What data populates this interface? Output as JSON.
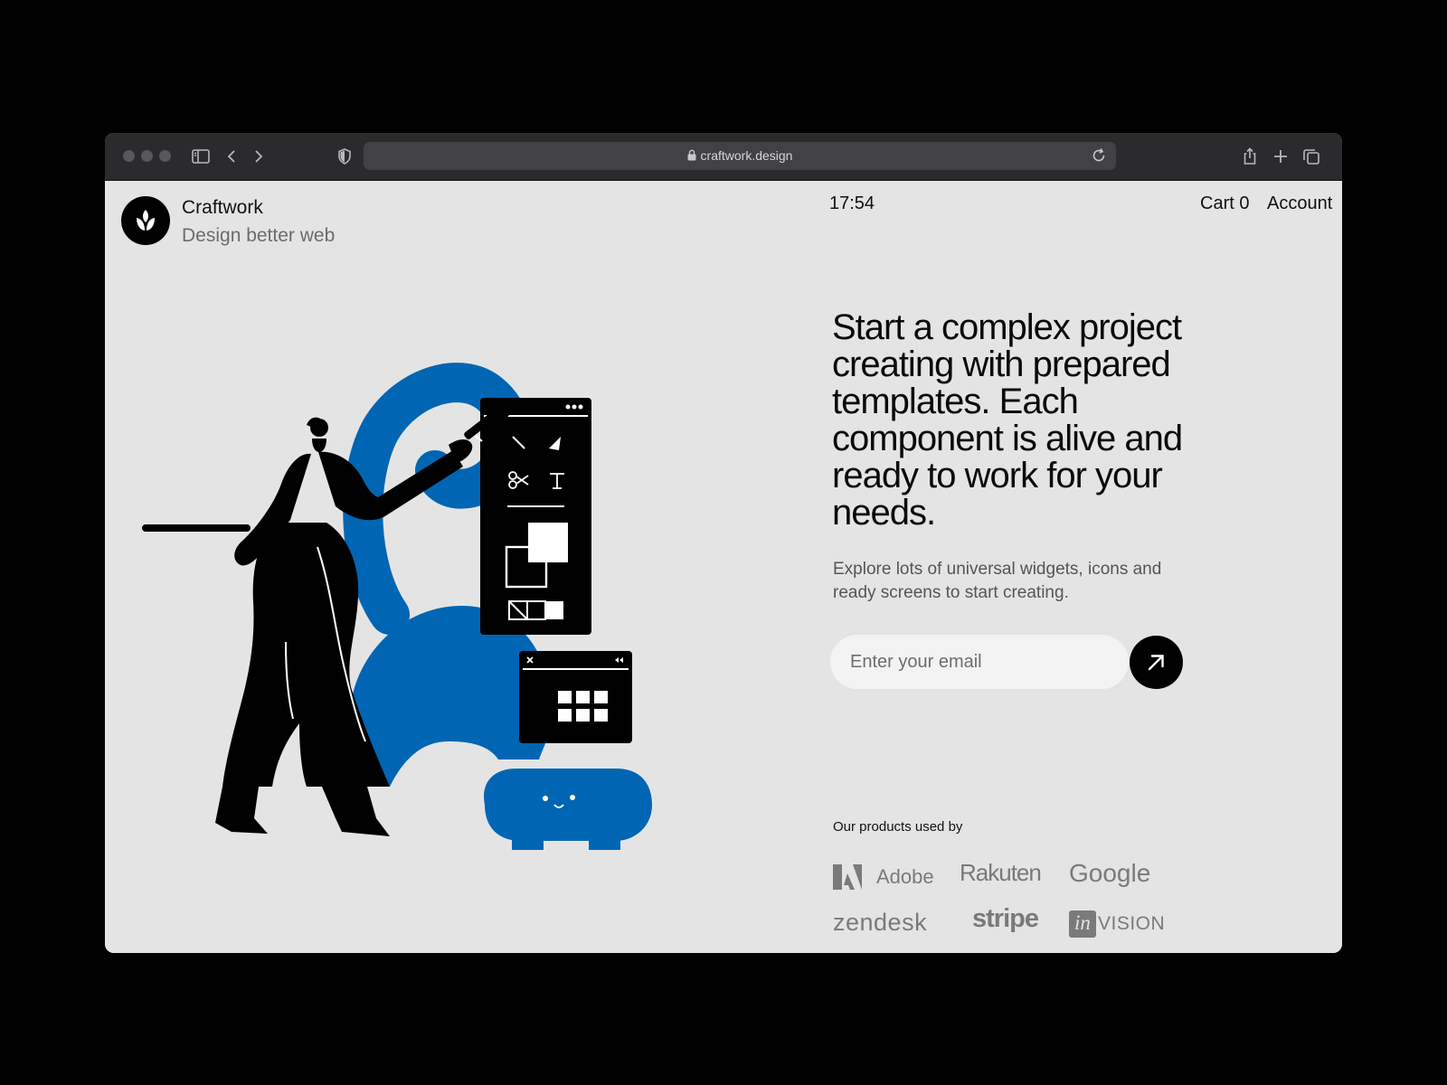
{
  "browser": {
    "url": "craftwork.design"
  },
  "header": {
    "brand_name": "Craftwork",
    "brand_tagline": "Design better web",
    "clock": "17:54",
    "cart_label": "Cart 0",
    "account_label": "Account"
  },
  "hero": {
    "headline": "Start a complex project creating with prepared templates. Each component is alive and ready to work for your needs.",
    "subheadline": "Explore lots of universal widgets, icons and ready screens to start creating.",
    "email_placeholder": "Enter your email"
  },
  "clients": {
    "label": "Our products used by",
    "logos": [
      "Adobe",
      "Rakuten",
      "Google",
      "zendesk",
      "stripe",
      "in",
      "VISION"
    ]
  },
  "colors": {
    "accent_blue": "#0066b3",
    "page_background": "#e4e4e4",
    "toolbar_background": "#2b2b2d"
  },
  "icons": {
    "sidebar": "sidebar-icon",
    "back": "chevron-left-icon",
    "forward": "chevron-right-icon",
    "privacy": "shield-icon",
    "lock": "lock-icon",
    "reload": "reload-icon",
    "share": "share-icon",
    "new_tab": "plus-icon",
    "tabs": "tabs-overview-icon",
    "submit": "arrow-up-right-icon",
    "brand": "leaf-icon"
  }
}
